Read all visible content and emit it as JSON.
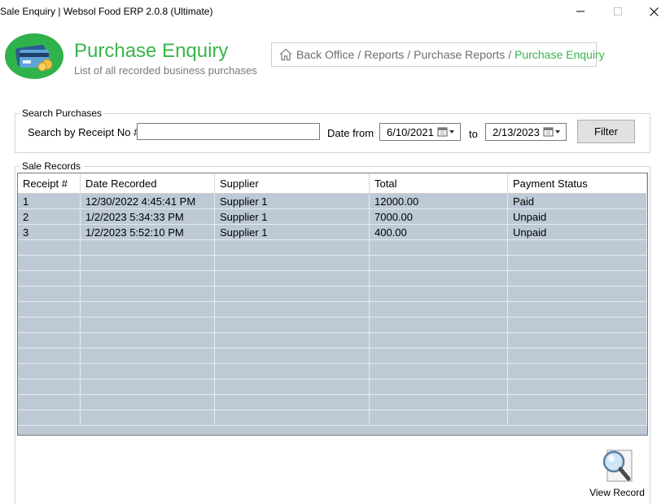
{
  "window": {
    "title": "Sale Enquiry | Websol Food ERP 2.0.8 (Ultimate)"
  },
  "header": {
    "title": "Purchase Enquiry",
    "subtitle": "List of all recorded business purchases",
    "logo_icon": "wallet-cards-icon",
    "accent": "#39b54a"
  },
  "breadcrumb": {
    "items": [
      "Back Office",
      "Reports",
      "Purchase Reports"
    ],
    "current": "Purchase Enquiry",
    "separator": "/"
  },
  "search": {
    "group_label": "Search Purchases",
    "receipt_label": "Search by Receipt No #",
    "receipt_value": "",
    "date_from_label": "Date from",
    "date_from": "6/10/2021",
    "to_label": "to",
    "date_to": "2/13/2023",
    "filter_label": "Filter"
  },
  "records": {
    "group_label": "Sale Records",
    "columns": [
      "Receipt #",
      "Date Recorded",
      "Supplier",
      "Total",
      "Payment Status"
    ],
    "rows": [
      [
        "1",
        "12/30/2022 4:45:41 PM",
        "Supplier 1",
        "12000.00",
        "Paid"
      ],
      [
        "2",
        "1/2/2023 5:34:33 PM",
        "Supplier 1",
        "7000.00",
        "Unpaid"
      ],
      [
        "3",
        "1/2/2023 5:52:10 PM",
        "Supplier 1",
        "400.00",
        "Unpaid"
      ]
    ],
    "empty_rows": 12,
    "row_color": "#bdcad6"
  },
  "actions": {
    "view_record_label": "View Record",
    "view_record_icon": "magnifier-icon"
  }
}
